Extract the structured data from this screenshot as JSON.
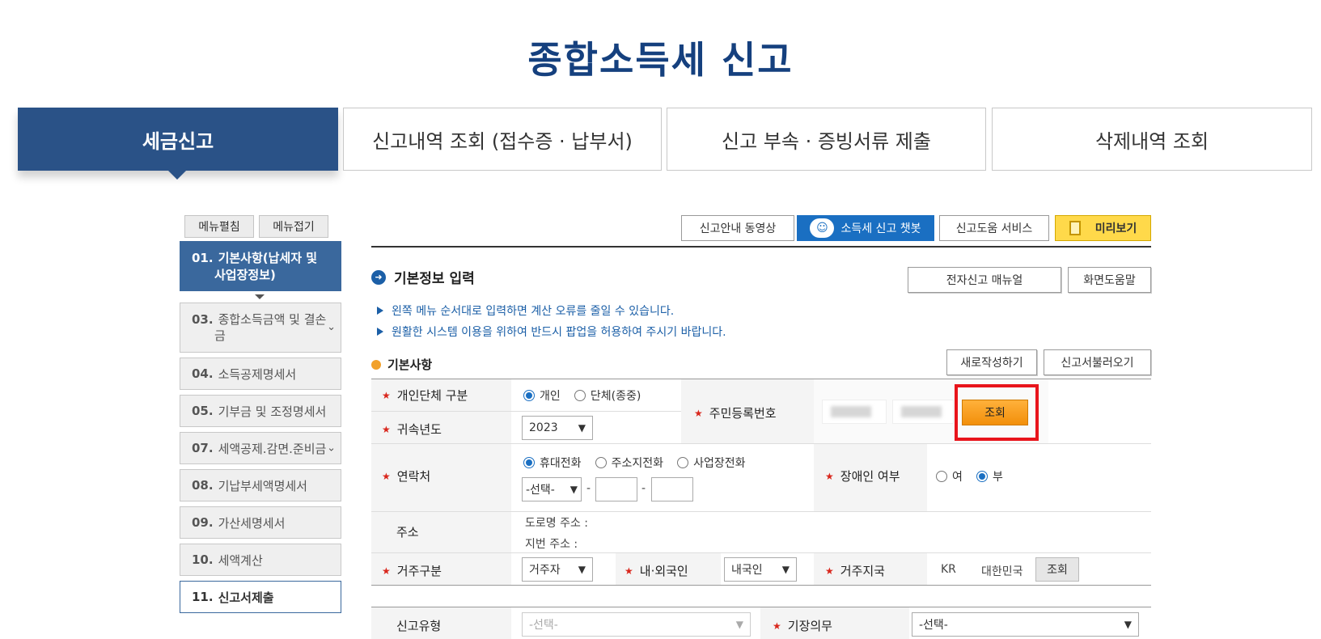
{
  "page_title": "종합소득세 신고",
  "top_tabs": [
    "세금신고",
    "신고내역 조회 (접수증 · 납부서)",
    "신고 부속 · 증빙서류 제출",
    "삭제내역 조회"
  ],
  "side_buttons": [
    "메뉴펼침",
    "메뉴접기"
  ],
  "side_menu": [
    {
      "num": "01.",
      "label": "기본사항(납세자 및",
      "label2": "사업장정보)"
    },
    {
      "num": "03.",
      "label": "종합소득금액 및 결손",
      "label2": "금"
    },
    {
      "num": "04.",
      "label": "소득공제명세서"
    },
    {
      "num": "05.",
      "label": "기부금 및 조정명세서"
    },
    {
      "num": "07.",
      "label": "세액공제.감면.준비금"
    },
    {
      "num": "08.",
      "label": "기납부세액명세서"
    },
    {
      "num": "09.",
      "label": "가산세명세서"
    },
    {
      "num": "10.",
      "label": "세액계산"
    },
    {
      "num": "11.",
      "label": "신고서제출"
    }
  ],
  "toolbar": {
    "video": "신고안내 동영상",
    "chatbot": "소득세 신고 챗봇",
    "help_service": "신고도움 서비스",
    "preview": "미리보기"
  },
  "section": {
    "title": "기본정보 입력",
    "manual": "전자신고 매뉴얼",
    "screen_help": "화면도움말",
    "info1": "왼쪽 메뉴 순서대로 입력하면 계산 오류를 줄일 수 있습니다.",
    "info2": "원활한 시스템 이용을 위하여 반드시 팝업을 허용하여 주시기 바랍니다.",
    "sub_title": "기본사항",
    "new_write": "새로작성하기",
    "load": "신고서불러오기"
  },
  "form": {
    "type_label": "개인단체 구분",
    "type_opt1": "개인",
    "type_opt2": "단체(종중)",
    "year_label": "귀속년도",
    "year_value": "2023",
    "rrn_label": "주민등록번호",
    "rrn_button": "조회",
    "contact_label": "연락처",
    "contact_opt1": "휴대전화",
    "contact_opt2": "주소지전화",
    "contact_opt3": "사업장전화",
    "contact_select": "-선택-",
    "dash": "-",
    "disabled_label": "장애인 여부",
    "disabled_yes": "여",
    "disabled_no": "부",
    "address_label": "주소",
    "road_address": "도로명 주소 :",
    "lot_address": "지번 주소 :",
    "residence_label": "거주구분",
    "residence_value": "거주자",
    "nationality_label": "내·외국인",
    "nationality_value": "내국인",
    "country_label": "거주지국",
    "country_code": "KR",
    "country_name": "대한민국",
    "country_button": "조회",
    "report_type_label": "신고유형",
    "report_type_value": "-선택-",
    "bookkeeping_label": "기장의무",
    "bookkeeping_value": "-선택-"
  },
  "colors": {
    "brand": "#15407e",
    "active_tab": "#2a5287",
    "side_active": "#3a689d",
    "accent_orange": "#f28f0a",
    "highlight": "#e8141b",
    "required": "#d9261c"
  }
}
